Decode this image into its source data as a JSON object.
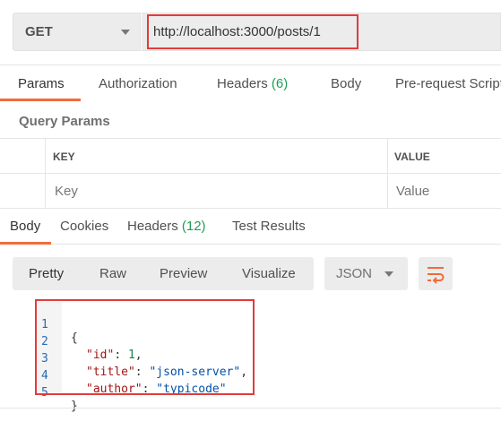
{
  "request": {
    "method": "GET",
    "url": "http://localhost:3000/posts/1"
  },
  "request_tabs": [
    {
      "label": "Params",
      "badge": ""
    },
    {
      "label": "Authorization",
      "badge": ""
    },
    {
      "label": "Headers",
      "badge": "(6)"
    },
    {
      "label": "Body",
      "badge": ""
    },
    {
      "label": "Pre-request Script",
      "badge": ""
    }
  ],
  "query_params": {
    "title": "Query Params",
    "columns": [
      "KEY",
      "VALUE"
    ],
    "placeholders": {
      "key": "Key",
      "value": "Value"
    }
  },
  "response_tabs": [
    {
      "label": "Body",
      "badge": ""
    },
    {
      "label": "Cookies",
      "badge": ""
    },
    {
      "label": "Headers",
      "badge": "(12)"
    },
    {
      "label": "Test Results",
      "badge": ""
    }
  ],
  "response_toolbar": {
    "views": [
      "Pretty",
      "Raw",
      "Preview",
      "Visualize"
    ],
    "format": "JSON",
    "wrap_icon": "wrap-lines-icon"
  },
  "response_body": {
    "line_numbers": [
      "1",
      "2",
      "3",
      "4",
      "5"
    ],
    "open_brace": "{",
    "close_brace": "}",
    "fields": [
      {
        "key": "\"id\"",
        "value": "1",
        "sep": ": ",
        "trail": ","
      },
      {
        "key": "\"title\"",
        "value": "\"json-server\"",
        "sep": ": ",
        "trail": ","
      },
      {
        "key": "\"author\"",
        "value": "\"typicode\"",
        "sep": ": ",
        "trail": ""
      }
    ]
  },
  "colors": {
    "accent": "#f26b3a",
    "highlight_box": "#e23b3b",
    "badge_green": "#1e9e55",
    "line_number_blue": "#2a6bb3"
  }
}
